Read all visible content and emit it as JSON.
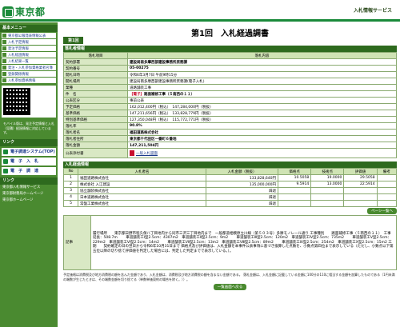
{
  "header": {
    "logo_text": "東京都",
    "service_title": "入札情報サービス"
  },
  "sidebar": {
    "menu_head": "基本メニュー",
    "items": [
      "東京都公報発表情報公表",
      "入札予定情報",
      "発注予定情報",
      "入札経過情報",
      "入札結果一覧",
      "発注・入札参加資格業者名簿",
      "登録関係情報",
      "入札参加資格情報"
    ],
    "qr_text": "モバイル版は、発注予定情報と入札（見積）経過情報に対応しています。",
    "other_head": "リンク",
    "buttons": [
      "電子調達システム(TOP)",
      "電　子　入　札",
      "電　子　調　達"
    ],
    "links_head": "リンク",
    "links": [
      "東京都入札情報サービス",
      "東京都財務局ホームページ",
      "東京都ホームページ"
    ]
  },
  "page": {
    "title": "第1回　入札経過調書",
    "tag": "第1回",
    "section1": "落札者情報",
    "col_item": "落札項目",
    "col_content": "落札内容",
    "rows": [
      {
        "label": "契約部署",
        "value": "建設局南多摩西部建設事務所庶務課"
      },
      {
        "label": "契約番号",
        "value": "05-00275"
      },
      {
        "label": "開札日時",
        "value": "令和6年3月7日 午前9時15分"
      },
      {
        "label": "開札場所",
        "value": "建設局南多摩西部建設事務所庶務課(電子入札)"
      },
      {
        "label": "業種",
        "value": "道路舗装工事"
      },
      {
        "label": "件　名",
        "prefix": "【電子】",
        "value": "路面補修工事（５南西の１１）"
      },
      {
        "label": "公表区分",
        "value": "事前公表"
      },
      {
        "label": "予定価格",
        "value": "162,012,400円（税込）　147,284,000円（税抜）"
      },
      {
        "label": "基準価格",
        "value": "147,211,656円（税込）　133,828,779円（税抜）"
      },
      {
        "label": "特別基準価格",
        "value": "127,350,048円（税込）　115,772,771円（税抜）"
      },
      {
        "label": "落札率",
        "value": "90.8%"
      },
      {
        "label": "落札者名",
        "value": "福田道路株式会社"
      },
      {
        "label": "落札者住所",
        "value": "東京都千代田区一番町６番地"
      },
      {
        "label": "落札金額",
        "value": "147,211,504円"
      }
    ],
    "docs_label": "公表添付書",
    "docs_link": "一般入札図面",
    "section2": "入札経過情報",
    "bid_headers": [
      "No",
      "入札者名",
      "入札金額（税抜）",
      "価格点",
      "技術点",
      "評価値",
      "備考"
    ],
    "bids": [
      {
        "no": "1",
        "name": "福田道路株式会社",
        "amount": "133,828,640円",
        "price": "10.5058",
        "tech": "19.0000",
        "score": "29.5058",
        "note": ""
      },
      {
        "no": "2",
        "name": "株式会社 入江建設",
        "amount": "135,000,000円",
        "price": "9.5914",
        "tech": "13.0000",
        "score": "22.5914",
        "note": ""
      },
      {
        "no": "3",
        "name": "協立舗装株式会社",
        "amount": "辞退",
        "price": "",
        "tech": "",
        "score": "",
        "note": ""
      },
      {
        "no": "4",
        "name": "日本道路株式会社",
        "amount": "辞退",
        "price": "",
        "tech": "",
        "score": "",
        "note": ""
      },
      {
        "no": "5",
        "name": "常盤工業株式会社",
        "amount": "辞退",
        "price": "",
        "tech": "",
        "score": "",
        "note": ""
      }
    ],
    "fav_btn": "ペーシ一覧へ",
    "notes_label": "記事",
    "notes_text": "履行場所　　東京都日野市程久保八丁目地内から同市三沢三丁目地内まで　一般都道相模原立川線（第５０３号）多摩モノレール通り 工事種別　　路面補修工事（５南西の１１）　工事延長：508.7m 　　車道舗装工Ⅰ型2.5cm：4307m2　車道舗装工Ⅱ型2.5cm：9m2 　　車道舗装工Ⅲ型2.5cm：120m2　車道舗装工Ⅳ型2.5cm：735m2 　　車道舗装工Ⅴ型2.5cm：229m2　車道舗装工Ⅵ型2.5cm：14m2 　　車道舗装工Ⅶ型2.5cm：13m2　車道舗装工Ⅷ型2.5cm：89m2 　　車道舗装工Ⅸ型2.5cm：254m2　車道舗装工Ⅹ型2.5cm：15m2 工　期　　契約確定の日の翌日から令和6年10月31日まで 価格点及び評価値は、入札金額を本事件公表事項に基づき換算した点数を、小数点第四位まで表示している（ただし、小数点以下第五位以降の切り捨て評価値を判定した場合には、判定した判定までで表示している。）。",
    "footnote": "予定価格は消費税及び地方消費税の額を含んだ金額であり、入札金額は、消費税及び地方消費税の額を含まない金額である。 落札金額は、入札金額に記載している金額に100分の110に相当する金額を加算したものである（1円未満の端数が生じたときは、その端数金額を切り捨てる（単数単価契約の場合を除く。））。",
    "back_btn": "一覧画面へ戻る"
  }
}
